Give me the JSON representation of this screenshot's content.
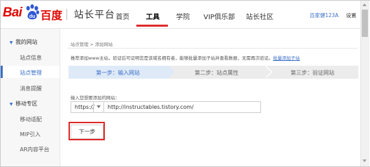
{
  "header": {
    "logo": {
      "left": "Bai",
      "right": "百度"
    },
    "site_title": "站长平台",
    "nav": [
      "首页",
      "工具",
      "学院",
      "VIP俱乐部",
      "站长社区"
    ],
    "active_nav": "工具",
    "user": "百家健123A",
    "settings": "设置"
  },
  "sidebar": {
    "sections": [
      {
        "title": "我的网站",
        "items": [
          "站点信息",
          "站点管理",
          "消息提醒"
        ]
      },
      {
        "title": "移动专区",
        "items": [
          "移动适配",
          "MIP引入",
          "AR内容平台"
        ]
      }
    ],
    "active_item": "站点管理"
  },
  "main": {
    "breadcrumb": "站点管理 > 添加网站",
    "notice": "推荐添加www主站，验证后可证明您是该域名拥有者，能够批量添加子站并查看数据，无需再次验证。",
    "notice_link": "批量添加子站",
    "steps": [
      "第一步：输入网站",
      "第二步：站点属性",
      "第三步：验证网站"
    ],
    "active_step": 0,
    "field_label": "输入您想要添加的网站：",
    "protocol": "https://",
    "url_value": "http://instructables.tistory.com/",
    "next_button": "下一步"
  },
  "colors": {
    "brand_red": "#e10601",
    "link_blue": "#3a6fc7",
    "step_active_bg": "#dfeaf8",
    "highlight_red": "#e02525"
  }
}
